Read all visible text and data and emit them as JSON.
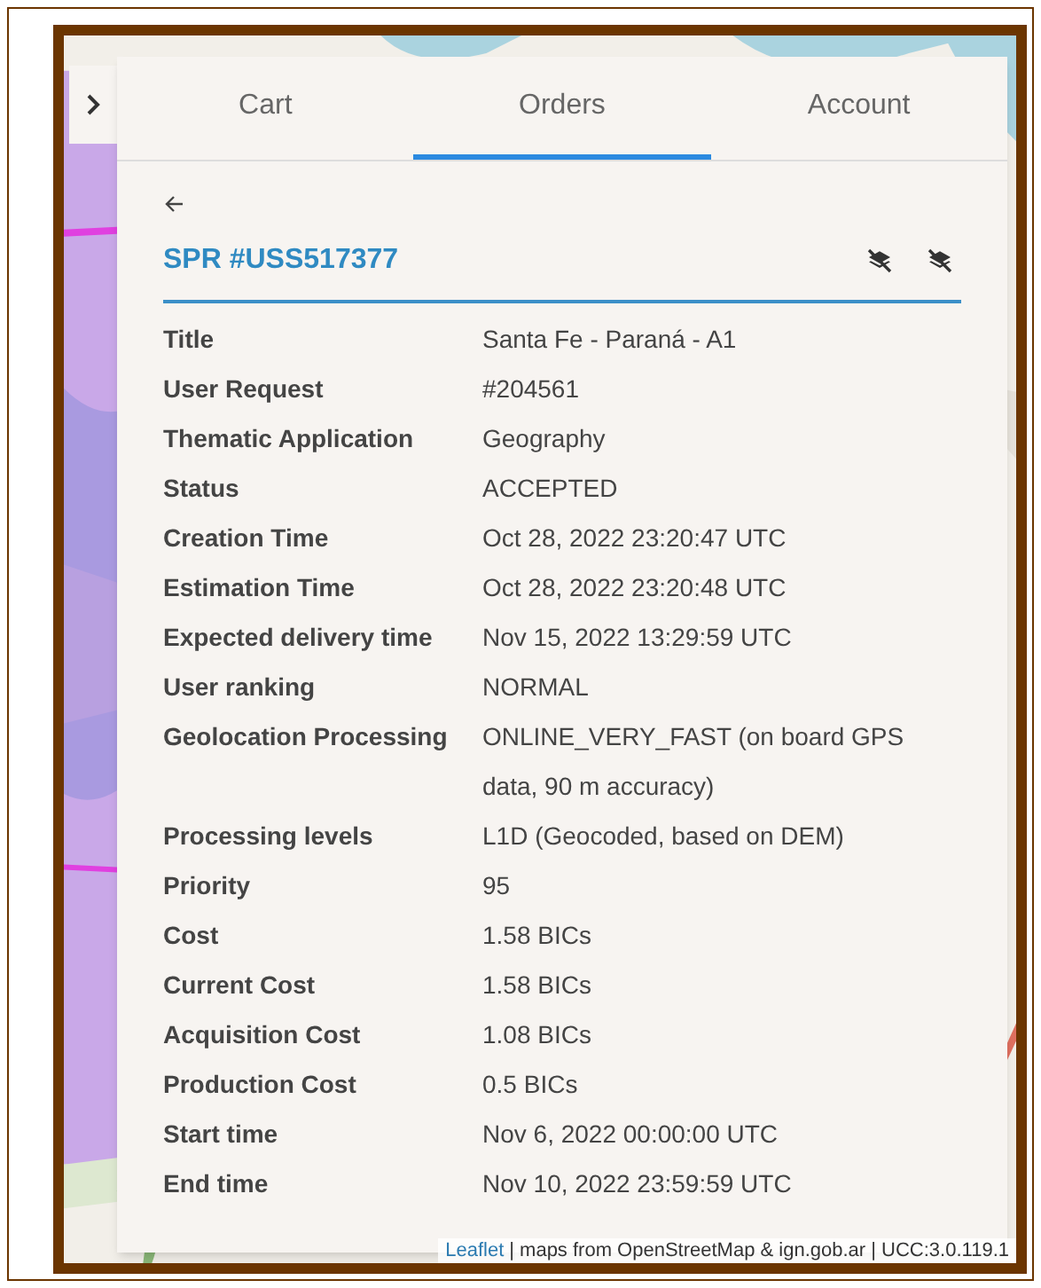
{
  "tabs": [
    {
      "label": "Cart",
      "selected": false
    },
    {
      "label": "Orders",
      "selected": true
    },
    {
      "label": "Account",
      "selected": false
    }
  ],
  "order": {
    "title": "SPR #USS517377"
  },
  "details": [
    {
      "label": "Title",
      "value": "Santa Fe - Paraná - A1"
    },
    {
      "label": "User Request",
      "value": "#204561"
    },
    {
      "label": "Thematic Application",
      "value": "Geography"
    },
    {
      "label": "Status",
      "value": "ACCEPTED"
    },
    {
      "label": "Creation Time",
      "value": "Oct 28, 2022 23:20:47 UTC"
    },
    {
      "label": "Estimation Time",
      "value": "Oct 28, 2022 23:20:48 UTC"
    },
    {
      "label": "Expected delivery time",
      "value": "Nov 15, 2022 13:29:59 UTC"
    },
    {
      "label": "User ranking",
      "value": "NORMAL"
    },
    {
      "label": "Geolocation Processing",
      "value": "ONLINE_VERY_FAST (on board GPS data, 90 m accuracy)"
    },
    {
      "label": "Processing levels",
      "value": "L1D (Geocoded, based on DEM)"
    },
    {
      "label": "Priority",
      "value": "95"
    },
    {
      "label": "Cost",
      "value": "1.58 BICs"
    },
    {
      "label": "Current Cost",
      "value": "1.58 BICs"
    },
    {
      "label": "Acquisition Cost",
      "value": "1.08 BICs"
    },
    {
      "label": "Production Cost",
      "value": "0.5 BICs"
    },
    {
      "label": "Start time",
      "value": "Nov 6, 2022 00:00:00 UTC"
    },
    {
      "label": "End time",
      "value": "Nov 10, 2022 23:59:59 UTC"
    }
  ],
  "attribution": {
    "link": "Leaflet",
    "text": "| maps from OpenStreetMap & ign.gob.ar | UCC:3.0.119.1"
  }
}
